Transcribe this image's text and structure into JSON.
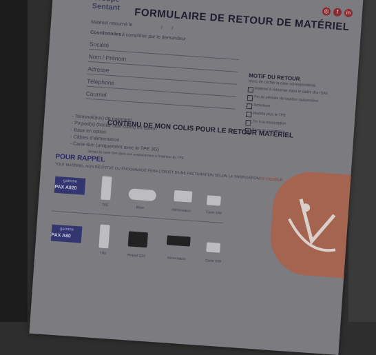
{
  "header": {
    "brand": "Groupe Sentant",
    "title": "FORMULAIRE DE RETOUR DE MATÉRIEL",
    "social_icons": [
      "instagram-icon",
      "facebook-icon",
      "linkedin-icon"
    ]
  },
  "form": {
    "materiel_retourne": "Matériel retourné le",
    "coordonnees": "Coordonnées",
    "coordonnees_hint": "à compléter par le demandeur",
    "fields": [
      "Société",
      "Nom / Prénom",
      "Adresse",
      "Téléphone",
      "Courriel"
    ]
  },
  "motif": {
    "title": "MOTIF DU RETOUR",
    "hint": "Merci de cocher la case correspondante",
    "options": [
      "Matériel à retourner dans le cadre d'un SAV",
      "Fin de période de location saisonnière",
      "Armoiture",
      "Modèle plus le TPE",
      "Fin à la souscription",
      "Perte du commerce"
    ]
  },
  "contenu": {
    "title": "CONTENU DE MON COLIS POUR LE RETOUR MATÉRIEL",
    "items": [
      "Terminal(aux) de paiement",
      "Pinpad(s) (boitier côté client) en option",
      "Base en option",
      "Câbles d'alimentation",
      "Carte Sim (uniquement avec le TPE 3G)"
    ],
    "note": "Jamais la carte Sim dans son emplacement à l'intérieur du TPE"
  },
  "rappel": {
    "title": "POUR RAPPEL",
    "subtitle_a": "TOUT MATÉRIEL NON RESTITUÉ OU ENDOMMAGÉ FERA L'OBJET D'UNE FACTURATION SELON LA TARIFICATION",
    "subtitle_b": "EN VIGUEUR",
    "gammes": [
      {
        "label": "gamme",
        "name": "PAX A920",
        "items": [
          "TPE",
          "Base",
          "Alimentation",
          "Carte SIM"
        ]
      },
      {
        "label": "gamme",
        "name": "PAX A80",
        "items": [
          "TPE",
          "Pinpad Q25",
          "Alimentation",
          "Carte SIM"
        ]
      }
    ]
  }
}
